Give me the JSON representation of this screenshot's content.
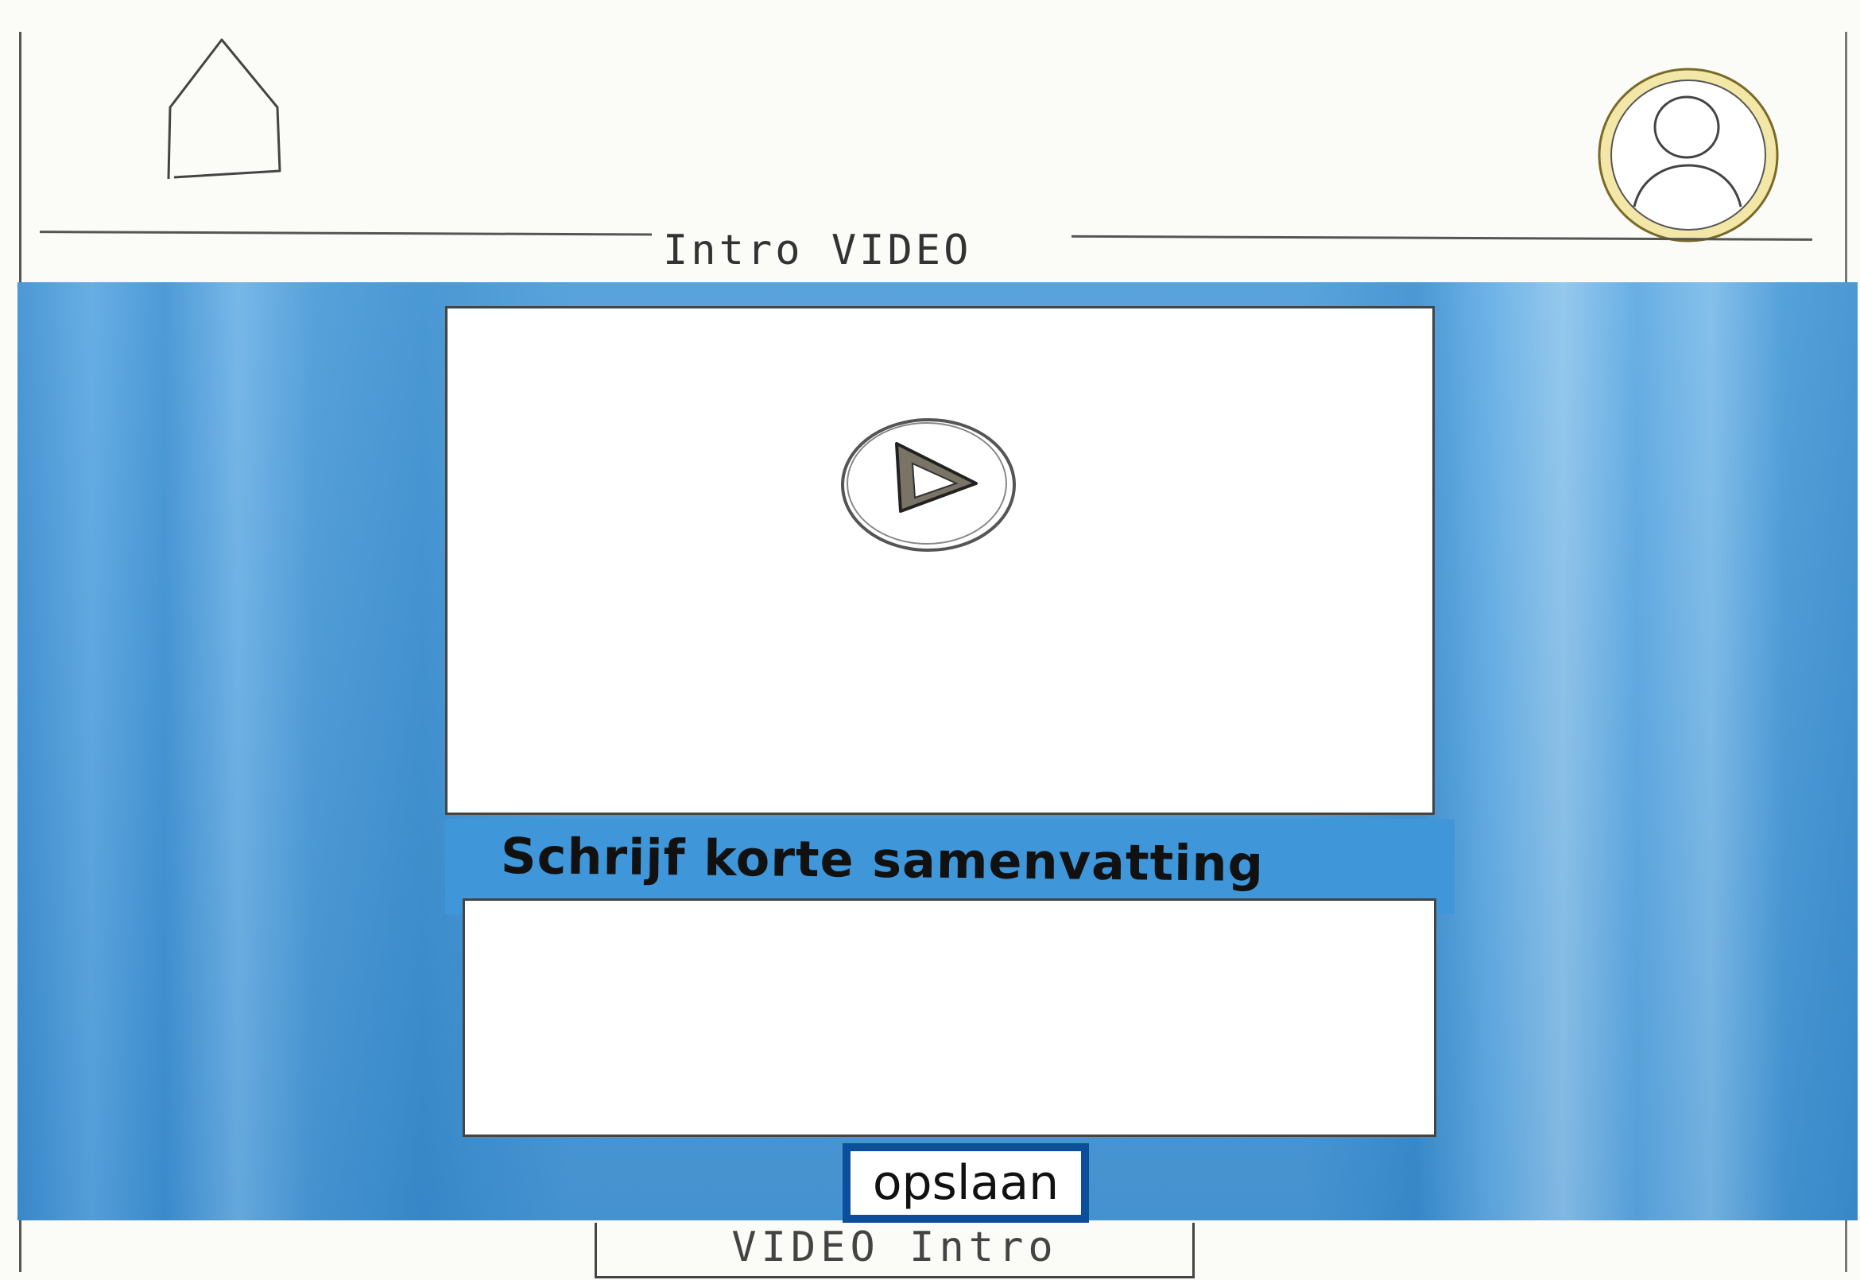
{
  "header": {
    "home_icon": "home-icon",
    "avatar_icon": "user-avatar-icon",
    "avatar_ring_color": "#e9d98a",
    "page_title": "Intro VIDEO"
  },
  "main": {
    "background_color": "#4b9bd9",
    "video": {
      "play_icon": "play-icon"
    },
    "summary": {
      "label": "Schrijf korte samenvatting",
      "value": "",
      "placeholder": ""
    },
    "save_label": "opslaan",
    "save_border_color": "#0b4f9a"
  },
  "footer": {
    "tab_label": "VIDEO Intro"
  }
}
